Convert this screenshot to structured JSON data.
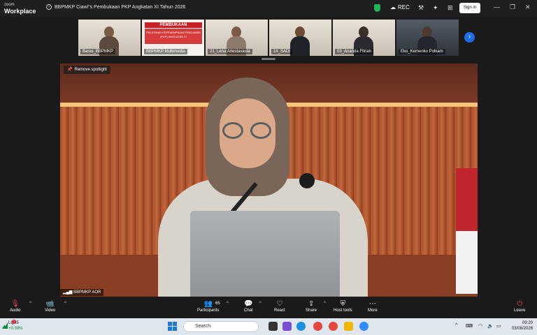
{
  "titlebar": {
    "app_logo_line1": "zoom",
    "app_logo_line2": "Workplace",
    "meeting_title": "BBPMKP Ciawi\"s Pembukaan PKP Angkatan XI Tahun 2026",
    "rec_label": "REC",
    "sign_in_label": "Sign in"
  },
  "strip": {
    "thumbs": [
      {
        "name": "Baras_BBPMKP"
      },
      {
        "name": "BBPMKP Multimedia",
        "banner_title": "PEMBUKAAN",
        "banner_text": "PELATIHAN KEPEMIMPINAN PENGAWAS (PKP) ANGKATAN XI"
      },
      {
        "name": "21_Lena Ariestavasta"
      },
      {
        "name": "14_SADI"
      },
      {
        "name": "03_Ananda Fitriah"
      },
      {
        "name": "Eko_Kemenko Polkam"
      }
    ]
  },
  "spotlight": {
    "remove_label": "Remove spotlight",
    "speaker_name": "BBPMKP AOR"
  },
  "toolbar": {
    "audio": "Audio",
    "video": "Video",
    "participants": "Participants",
    "participants_count": "65",
    "chat": "Chat",
    "react": "React",
    "share": "Share",
    "host_tools": "Host tools",
    "more": "More",
    "leave": "Leave"
  },
  "taskbar": {
    "stock_symbol": "LQ45",
    "stock_change": "+0.39%",
    "notification_count": "1",
    "search_placeholder": "Search",
    "time": "09:20",
    "date": "03/08/2026"
  }
}
